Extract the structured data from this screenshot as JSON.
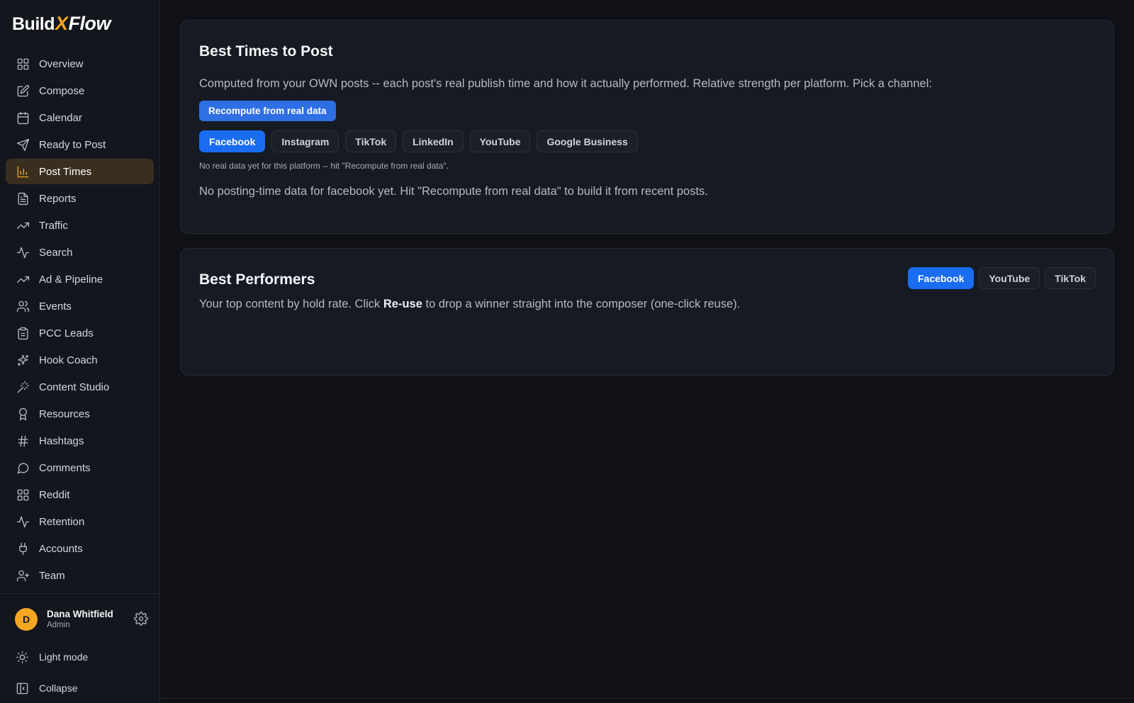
{
  "brand": {
    "part1": "Build",
    "part2": "X",
    "part3": "Flow",
    "accent": "#f5a623"
  },
  "sidebar": {
    "items": [
      {
        "label": "Overview",
        "icon": "grid-icon"
      },
      {
        "label": "Compose",
        "icon": "edit-icon"
      },
      {
        "label": "Calendar",
        "icon": "calendar-icon"
      },
      {
        "label": "Ready to Post",
        "icon": "send-icon"
      },
      {
        "label": "Post Times",
        "icon": "bar-chart-icon",
        "active": true
      },
      {
        "label": "Reports",
        "icon": "document-icon"
      },
      {
        "label": "Traffic",
        "icon": "trending-up-icon"
      },
      {
        "label": "Search",
        "icon": "pulse-icon"
      },
      {
        "label": "Ad & Pipeline",
        "icon": "trending-up-icon"
      },
      {
        "label": "Events",
        "icon": "users-icon"
      },
      {
        "label": "PCC Leads",
        "icon": "clipboard-icon"
      },
      {
        "label": "Hook Coach",
        "icon": "sparkles-icon"
      },
      {
        "label": "Content Studio",
        "icon": "wand-icon"
      },
      {
        "label": "Resources",
        "icon": "award-icon"
      },
      {
        "label": "Hashtags",
        "icon": "hash-icon"
      },
      {
        "label": "Comments",
        "icon": "message-icon"
      },
      {
        "label": "Reddit",
        "icon": "grid-icon"
      },
      {
        "label": "Retention",
        "icon": "pulse-icon"
      },
      {
        "label": "Accounts",
        "icon": "plug-icon"
      },
      {
        "label": "Team",
        "icon": "user-plus-icon"
      }
    ],
    "user": {
      "initial": "D",
      "name": "Dana Whitfield",
      "role": "Admin"
    },
    "light_mode": "Light mode",
    "collapse": "Collapse"
  },
  "best_times": {
    "title": "Best Times to Post",
    "description": "Computed from your OWN posts -- each post's real publish time and how it actually performed. Relative strength per platform. Pick a channel:",
    "recompute_label": "Recompute from real data",
    "platforms": [
      "Facebook",
      "Instagram",
      "TikTok",
      "LinkedIn",
      "YouTube",
      "Google Business"
    ],
    "selected_platform": "Facebook",
    "note": "No real data yet for this platform -- hit \"Recompute from real data\".",
    "empty_message": "No posting-time data for facebook yet. Hit \"Recompute from real data\" to build it from recent posts."
  },
  "best_performers": {
    "title": "Best Performers",
    "desc_before": "Your top content by hold rate. Click ",
    "desc_bold": "Re-use",
    "desc_after": " to drop a winner straight into the composer (one-click reuse).",
    "platforms": [
      "Facebook",
      "YouTube",
      "TikTok"
    ],
    "selected_platform": "Facebook"
  },
  "colors": {
    "primary": "#1a6cf0",
    "background": "#0f1117",
    "card": "#161a23"
  }
}
